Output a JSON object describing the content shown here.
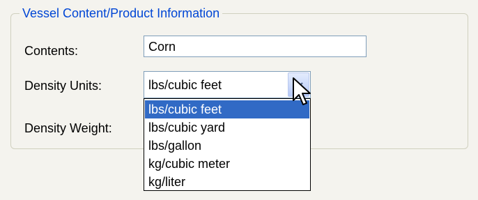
{
  "group": {
    "title": "Vessel Content/Product Information"
  },
  "fields": {
    "contents_label": "Contents:",
    "contents_value": "Corn",
    "density_units_label": "Density Units:",
    "density_units_value": "lbs/cubic feet",
    "density_weight_label": "Density Weight:"
  },
  "dropdown": {
    "options": [
      "lbs/cubic feet",
      "lbs/cubic yard",
      "lbs/gallon",
      "kg/cubic meter",
      "kg/liter"
    ],
    "selected_index": 0
  },
  "colors": {
    "background": "#f4f3ee",
    "legend_text": "#0046d5",
    "selection": "#316ac5",
    "field_border": "#7f9db9"
  },
  "icons": {
    "combo_arrow": "chevron-down-icon",
    "pointer": "mouse-pointer-icon"
  }
}
